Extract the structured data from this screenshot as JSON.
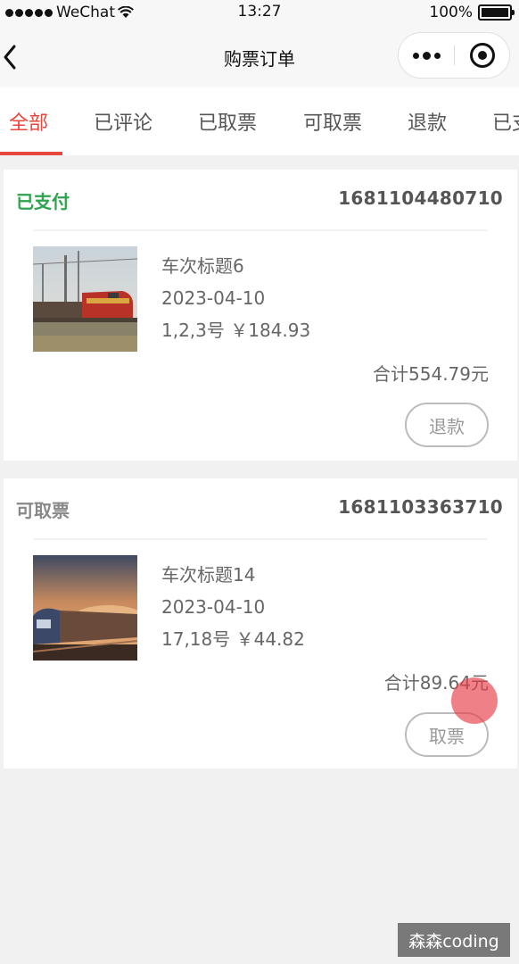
{
  "status_bar": {
    "carrier": "WeChat",
    "time": "13:27",
    "battery": "100%"
  },
  "nav": {
    "title": "购票订单"
  },
  "tabs": [
    {
      "label": "全部",
      "active": true
    },
    {
      "label": "已评论"
    },
    {
      "label": "已取票"
    },
    {
      "label": "可取票"
    },
    {
      "label": "退款"
    },
    {
      "label": "已支"
    }
  ],
  "orders": [
    {
      "status": "已支付",
      "status_color": "#2ea44f",
      "order_no": "1681104480710",
      "title": "车次标题6",
      "date": "2023-04-10",
      "seats_price": "1,2,3号 ￥184.93",
      "total": "合计554.79元",
      "action": "退款"
    },
    {
      "status": "可取票",
      "status_color": "#888888",
      "order_no": "1681103363710",
      "title": "车次标题14",
      "date": "2023-04-10",
      "seats_price": "17,18号 ￥44.82",
      "total": "合计89.64元",
      "action": "取票"
    }
  ],
  "watermark": "森森coding",
  "colors": {
    "accent": "#e8463c",
    "paid": "#2ea44f"
  }
}
